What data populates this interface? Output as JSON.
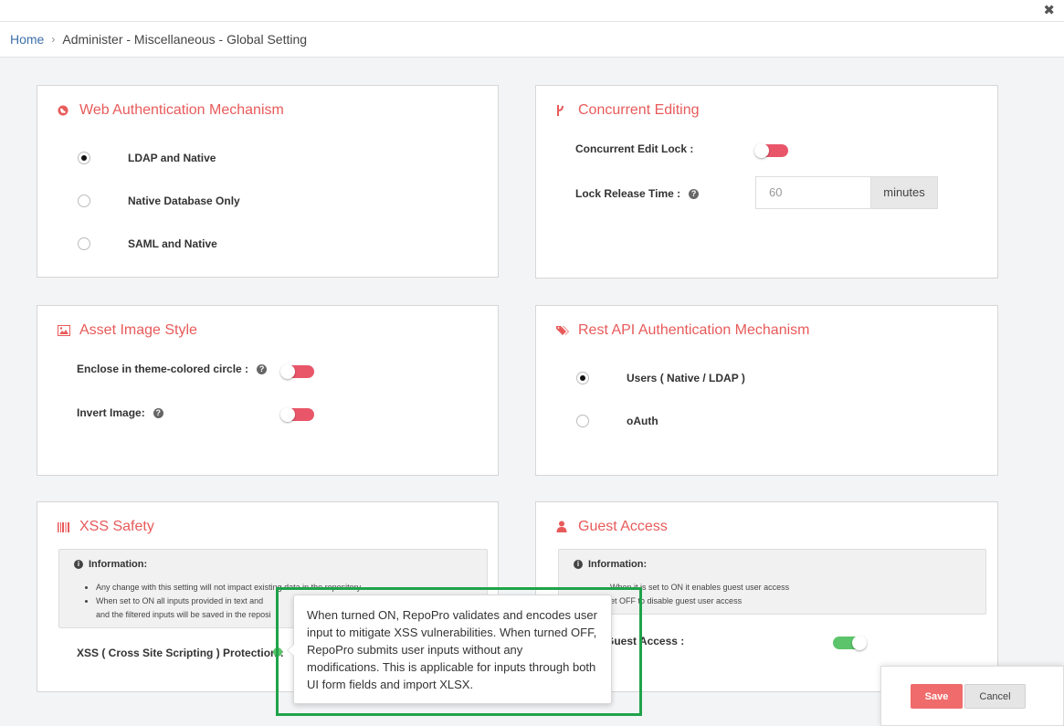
{
  "window": {
    "close_glyph": "✖"
  },
  "breadcrumb": {
    "home": "Home",
    "separator": "›",
    "current": "Administer - Miscellaneous - Global Setting"
  },
  "web_auth": {
    "title": "Web Authentication Mechanism",
    "icon": "globe-icon",
    "options": [
      {
        "label": "LDAP and Native",
        "checked": true
      },
      {
        "label": "Native Database Only",
        "checked": false
      },
      {
        "label": "SAML and Native",
        "checked": false
      }
    ]
  },
  "concurrent": {
    "title": "Concurrent Editing",
    "icon": "branch-icon",
    "lock_label": "Concurrent Edit Lock :",
    "lock_state": "off",
    "release_label": "Lock Release Time :",
    "release_placeholder": "60",
    "release_unit": "minutes"
  },
  "asset_image": {
    "title": "Asset Image Style",
    "icon": "image-icon",
    "enclose_label": "Enclose in theme-colored circle :",
    "enclose_state": "off",
    "invert_label": "Invert Image:",
    "invert_state": "off"
  },
  "rest_api": {
    "title": "Rest API Authentication Mechanism",
    "icon": "tags-icon",
    "options": [
      {
        "label": "Users ( Native / LDAP )",
        "checked": true
      },
      {
        "label": "oAuth",
        "checked": false
      }
    ]
  },
  "xss": {
    "title": "XSS Safety",
    "icon": "barcode-icon",
    "info_title": "Information:",
    "info_items": [
      "Any change with this setting will not impact existing data in the repository",
      "When set to ON all inputs provided in text and",
      "and the filtered inputs will be saved in the reposi"
    ],
    "protection_label": "XSS ( Cross Site Scripting ) Protection :"
  },
  "guest": {
    "title": "Guest Access",
    "icon": "user-icon",
    "info_title": "Information:",
    "info_items": [
      "When it is set to ON it enables guest user access",
      "et OFF to disable guest user access"
    ],
    "access_label": "Guest Access :",
    "access_state": "on"
  },
  "tooltip": {
    "text": "When turned ON, RepoPro validates and encodes user input to mitigate XSS vulnerabilities. When turned OFF, RepoPro submits user inputs without any modifications. This is applicable for inputs through both UI form fields and import XLSX."
  },
  "footer": {
    "save": "Save",
    "cancel": "Cancel"
  },
  "colors": {
    "accent": "#e85a5a",
    "toggle_off": "#e9566a",
    "toggle_on": "#5cc46a",
    "highlight": "#1fa34a",
    "save_button": "#f06b6b"
  }
}
